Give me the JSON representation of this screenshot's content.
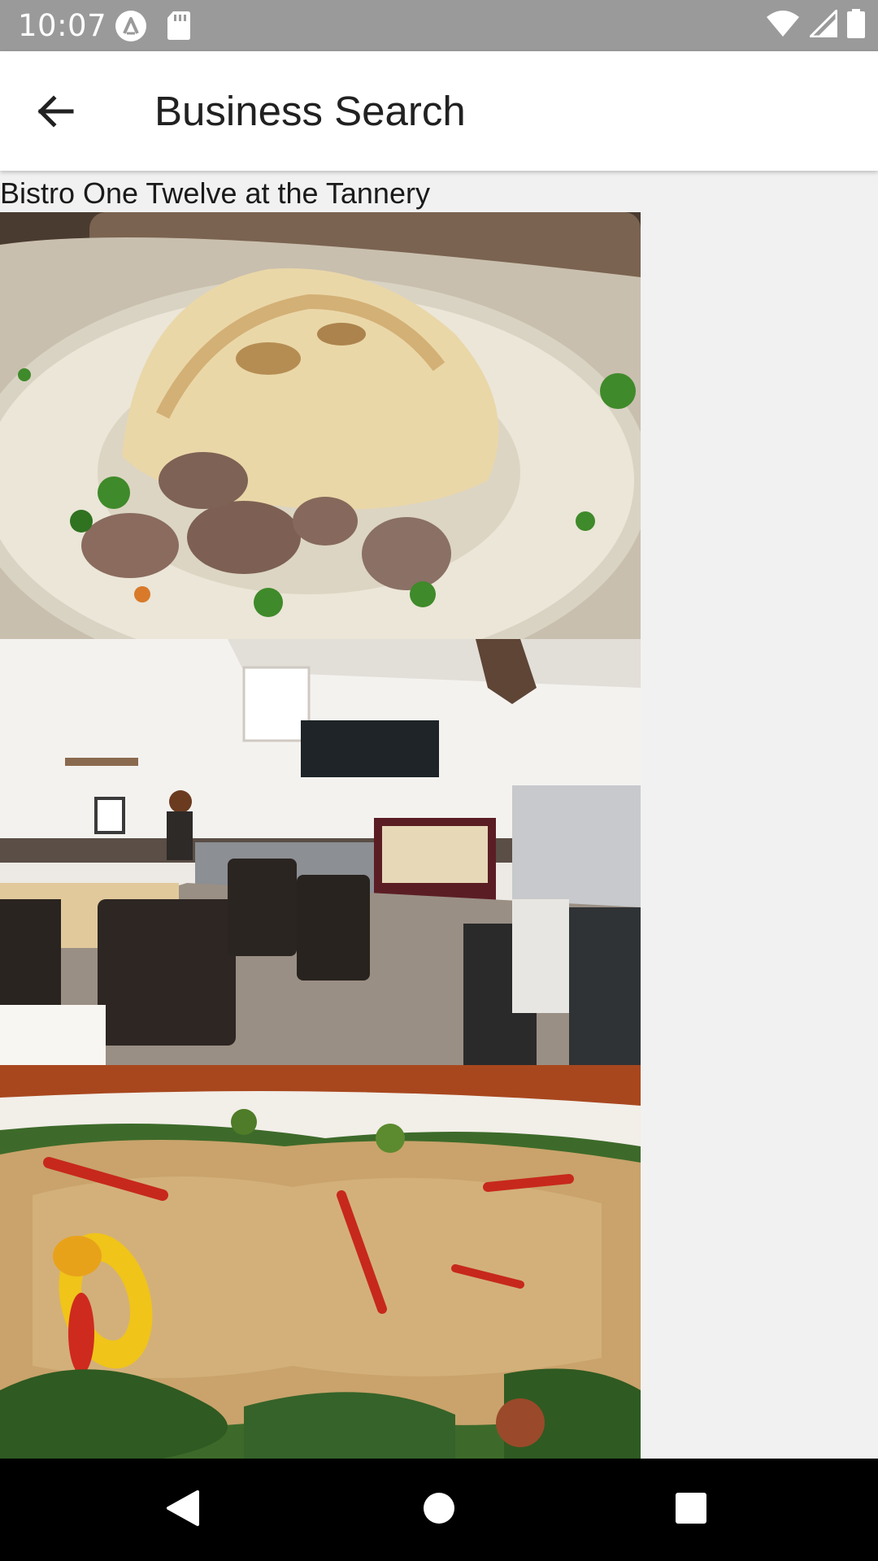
{
  "status_bar": {
    "time": "10:07",
    "left_icons": [
      "app-notification-icon",
      "sd-card-icon"
    ],
    "right_icons": [
      "wifi-icon",
      "cell-signal-icon",
      "battery-icon"
    ],
    "background": "#9a9a9a"
  },
  "app_bar": {
    "title": "Business Search",
    "back_icon": "arrow-back-icon"
  },
  "business": {
    "name": "Bistro One Twelve at the Tannery",
    "photos": [
      {
        "name": "shepherds-pie-photo"
      },
      {
        "name": "dining-room-photo"
      },
      {
        "name": "quinoa-salad-photo"
      }
    ]
  },
  "nav_bar": {
    "buttons": [
      "back-triangle-icon",
      "home-circle-icon",
      "recents-square-icon"
    ]
  }
}
